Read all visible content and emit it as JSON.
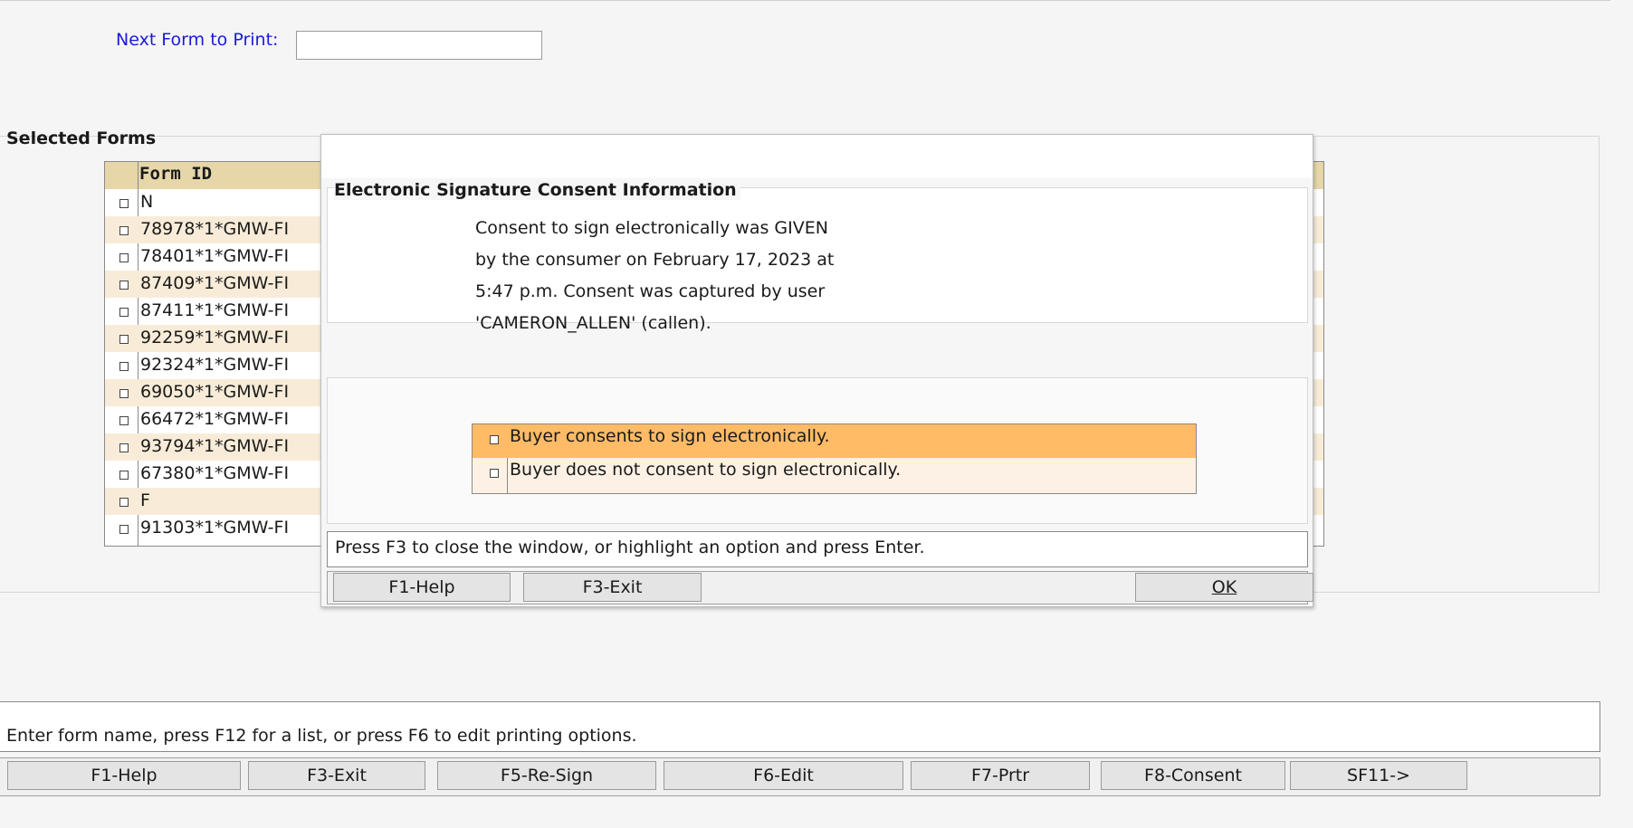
{
  "header": {
    "next_form_label": "Next Form to Print:",
    "next_form_value": ""
  },
  "selected_forms": {
    "title": "Selected Forms",
    "column_header": "Form ID",
    "rows": [
      "N",
      "78978*1*GMW-FI",
      "78401*1*GMW-FI",
      "87409*1*GMW-FI",
      "87411*1*GMW-FI",
      "92259*1*GMW-FI",
      "92324*1*GMW-FI",
      "69050*1*GMW-FI",
      "66472*1*GMW-FI",
      "93794*1*GMW-FI",
      "67380*1*GMW-FI",
      "F",
      "91303*1*GMW-FI"
    ]
  },
  "dialog": {
    "title": "",
    "section_title": "Electronic Signature Consent Information",
    "consent_lines": [
      "Consent to sign electronically was GIVEN",
      "by the consumer on February 17, 2023 at",
      "5:47 p.m.  Consent was captured by user",
      "'CAMERON_ALLEN' (callen)."
    ],
    "options": [
      {
        "label": "Buyer consents to sign electronically.",
        "selected": true
      },
      {
        "label": "Buyer does not consent to sign electronically.",
        "selected": false
      }
    ],
    "status": "Press F3 to close the window, or highlight an option and press Enter.",
    "buttons": {
      "help": "F1-Help",
      "exit": "F3-Exit",
      "ok": "OK"
    }
  },
  "bottom": {
    "status": "Enter form name, press F12 for a list, or press F6 to edit printing options.",
    "buttons": [
      "F1-Help",
      "F3-Exit",
      "F5-Re-Sign",
      "F6-Edit",
      "F7-Prtr",
      "F8-Consent",
      "SF11->"
    ]
  },
  "colors": {
    "label_blue": "#1a1adc",
    "grid_header": "#e6d6a8",
    "grid_alt_row": "#f8ecd8",
    "option_selected": "#ffbb66",
    "option_bg": "#fcf1e4"
  }
}
